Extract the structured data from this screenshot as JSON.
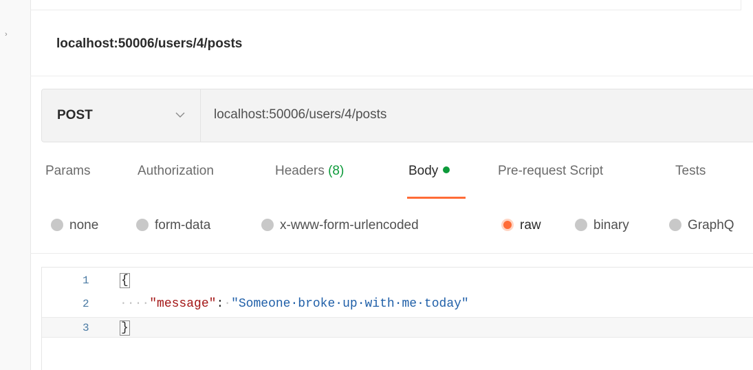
{
  "request": {
    "title": "localhost:50006/users/4/posts",
    "method": "POST",
    "url": "localhost:50006/users/4/posts"
  },
  "tabs": [
    {
      "label": "Params"
    },
    {
      "label": "Authorization"
    },
    {
      "label": "Headers",
      "count": "(8)"
    },
    {
      "label": "Body",
      "active": true
    },
    {
      "label": "Pre-request Script"
    },
    {
      "label": "Tests"
    }
  ],
  "body_options": [
    {
      "label": "none"
    },
    {
      "label": "form-data"
    },
    {
      "label": "x-www-form-urlencoded"
    },
    {
      "label": "raw",
      "selected": true
    },
    {
      "label": "binary"
    },
    {
      "label": "GraphQ"
    }
  ],
  "editor": {
    "lines": [
      {
        "number": "1",
        "code": "{"
      },
      {
        "number": "2",
        "indent": "····",
        "key": "\"message\"",
        "sep": ":",
        "value": "\"Someone·broke·up·with·me·today\""
      },
      {
        "number": "3",
        "code": "}"
      }
    ]
  },
  "colors": {
    "accent": "#ff6c37",
    "status_green": "#0d9a3a",
    "json_key": "#a31515",
    "json_string": "#1f5fa8"
  }
}
